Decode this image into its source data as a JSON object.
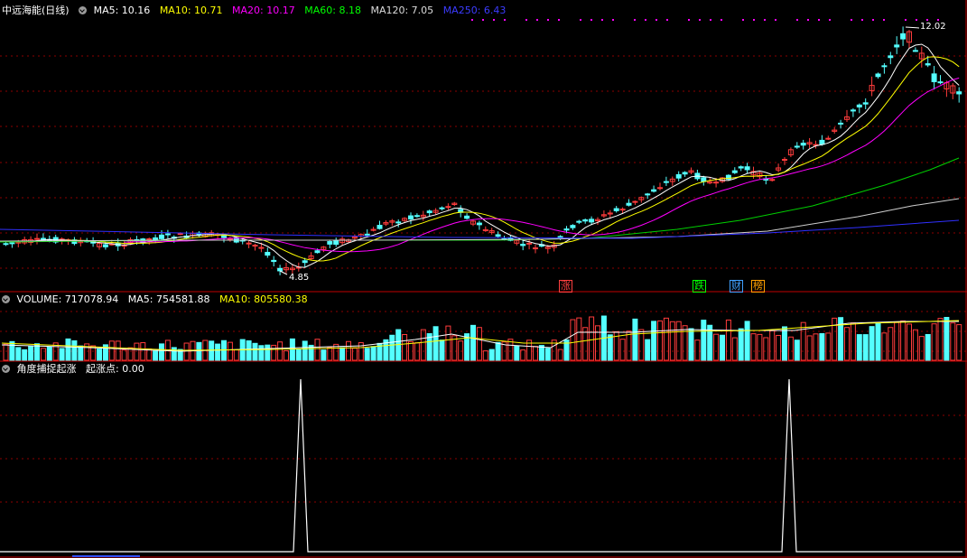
{
  "price_panel": {
    "stock_name": "中远海能(日线)",
    "indicators": [
      {
        "label": "MA5: 10.16",
        "color": "#ffffff"
      },
      {
        "label": "MA10: 10.71",
        "color": "#ffff00"
      },
      {
        "label": "MA20: 10.17",
        "color": "#ff00ff"
      },
      {
        "label": "MA60: 8.18",
        "color": "#00ff00"
      },
      {
        "label": "MA120: 7.05",
        "color": "#dcdcdc"
      },
      {
        "label": "MA250: 6.43",
        "color": "#3c3cff"
      }
    ],
    "high_label": "12.02",
    "low_label": "4.85",
    "event_tags": [
      {
        "text": "涨",
        "color": "#ff4040",
        "border": "#ff4040"
      },
      {
        "text": "跌",
        "color": "#00ff00",
        "border": "#00ff00"
      },
      {
        "text": "财",
        "color": "#40a0ff",
        "border": "#40a0ff"
      },
      {
        "text": "榜",
        "color": "#ffa000",
        "border": "#ffa000"
      }
    ]
  },
  "volume_panel": {
    "indicators": [
      {
        "label": "VOLUME: 717078.94",
        "color": "#ffffff"
      },
      {
        "label": "MA5: 754581.88",
        "color": "#ffffff"
      },
      {
        "label": "MA10: 805580.38",
        "color": "#ffff00"
      }
    ]
  },
  "indicator_panel": {
    "indicators": [
      {
        "label": "角度捕捉起涨",
        "color": "#ffffff"
      },
      {
        "label": "起涨点: 0.00",
        "color": "#ffffff"
      }
    ]
  },
  "colors": {
    "up": "#ff3c3c",
    "down": "#54ffff",
    "grid": "#8b0000",
    "panel_border": "#c00000"
  }
}
